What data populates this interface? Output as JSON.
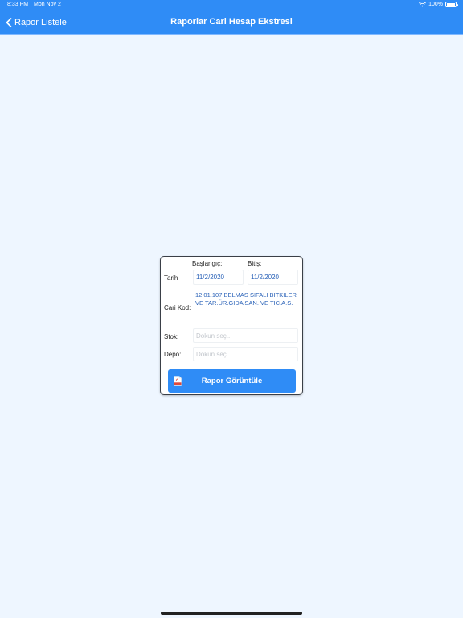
{
  "status_bar": {
    "time": "8:33 PM",
    "date": "Mon Nov 2",
    "battery": "100%"
  },
  "nav": {
    "back_label": "Rapor Listele",
    "title": "Raporlar Cari Hesap Ekstresi"
  },
  "form": {
    "start_header": "Başlangıç:",
    "end_header": "Bitiş:",
    "date_label": "Tarih",
    "start_date": "11/2/2020",
    "end_date": "11/2/2020",
    "cari_label": "Cari Kod:",
    "cari_value": "12.01.107 BELMAS SIFALI BITKILER VE TAR.ÜR.GIDA SAN. VE TIC.A.S.",
    "stok_label": "Stok:",
    "stok_placeholder": "Dokun seç...",
    "depo_label": "Depo:",
    "depo_placeholder": "Dokun seç...",
    "button_label": "Rapor Görüntüle"
  },
  "colors": {
    "accent": "#2f8cf6",
    "background": "#eef6ff",
    "value_text": "#2a62b8"
  }
}
